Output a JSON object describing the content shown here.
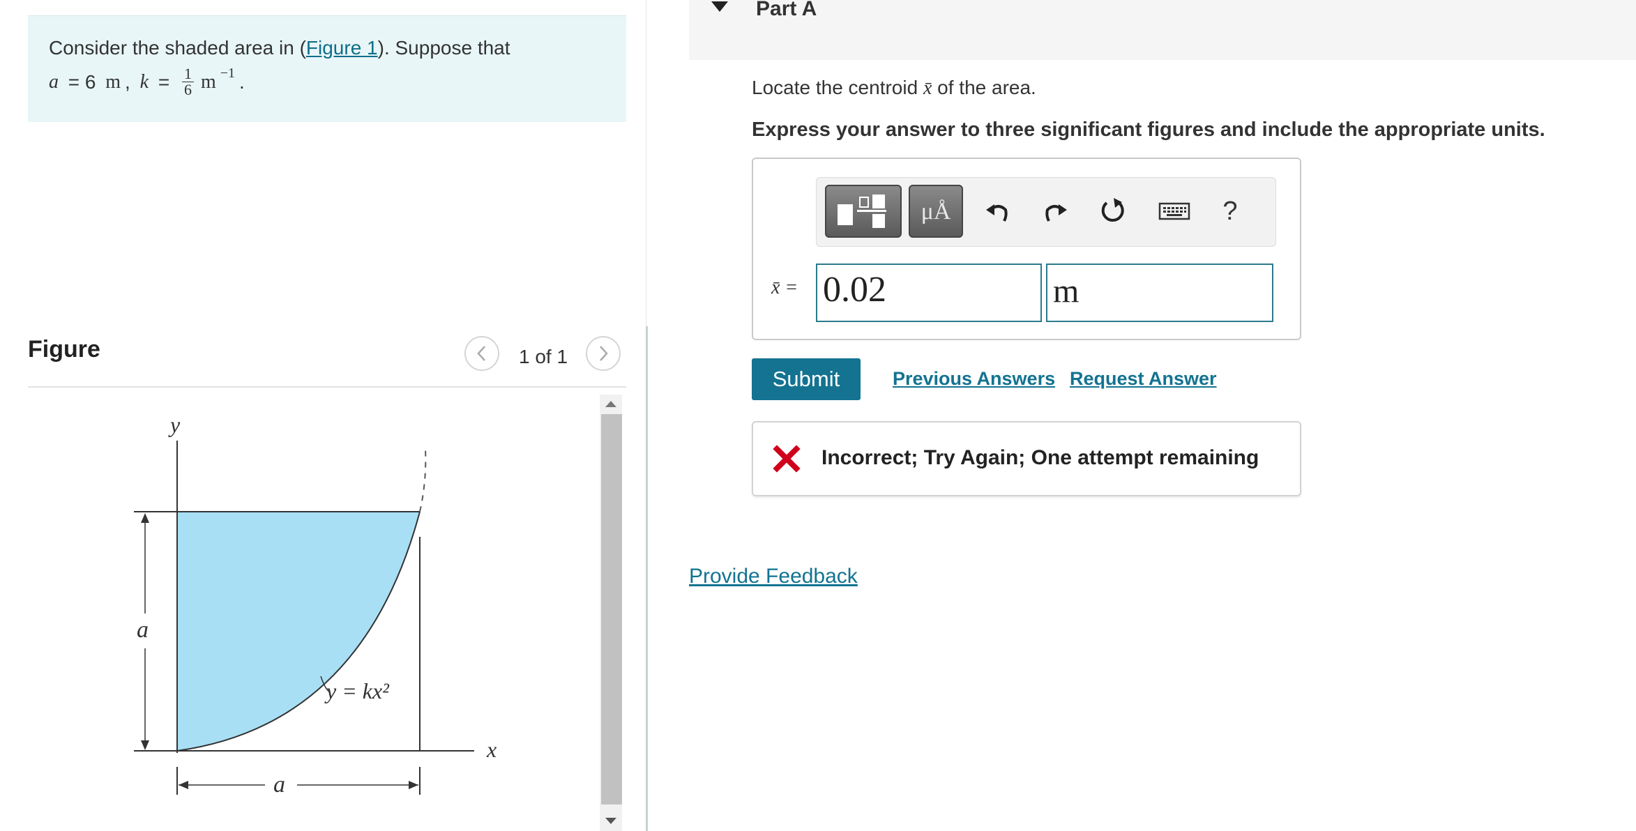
{
  "problem": {
    "intro_text": "Consider the shaded area in (",
    "figure_link": "Figure 1",
    "intro_tail": "). Suppose that",
    "a_var": "a",
    "a_eq": " = 6 ",
    "a_unit": "m",
    "comma": ", ",
    "k_var": "k",
    "k_eq": " = ",
    "k_num": "1",
    "k_den": "6",
    "k_unit": "m",
    "k_exp": "−1",
    "period": "."
  },
  "figure_panel": {
    "title": "Figure",
    "counter": "1 of 1",
    "prev_icon": "chevron-left-icon",
    "next_icon": "chevron-right-icon",
    "labels": {
      "y_axis": "y",
      "x_axis": "x",
      "a_vertical": "a",
      "a_horizontal": "a",
      "curve": "y = kx²"
    },
    "fill_color": "#a8dff5"
  },
  "part": {
    "title": "Part A",
    "question_pre": "Locate the centroid ",
    "question_var": "x̄",
    "question_post": " of the area.",
    "instruction": "Express your answer to three significant figures and include the appropriate units."
  },
  "answer": {
    "toolbar": {
      "units_label": "μÅ",
      "help_label": "?",
      "icons": [
        "templates-icon",
        "units-icon",
        "undo-icon",
        "redo-icon",
        "reset-icon",
        "keyboard-icon",
        "help-icon"
      ]
    },
    "xbar_label": "x̄ =",
    "value": "0.02",
    "unit": "m"
  },
  "actions": {
    "submit": "Submit",
    "previous_answers": "Previous Answers",
    "request_answer": "Request Answer"
  },
  "feedback": {
    "message": "Incorrect; Try Again; One attempt remaining",
    "icon": "x-mark-icon",
    "color": "#d0021b"
  },
  "footer": {
    "provide_feedback": "Provide Feedback"
  },
  "colors": {
    "accent": "#137391",
    "problem_bg": "#e8f6f7"
  }
}
